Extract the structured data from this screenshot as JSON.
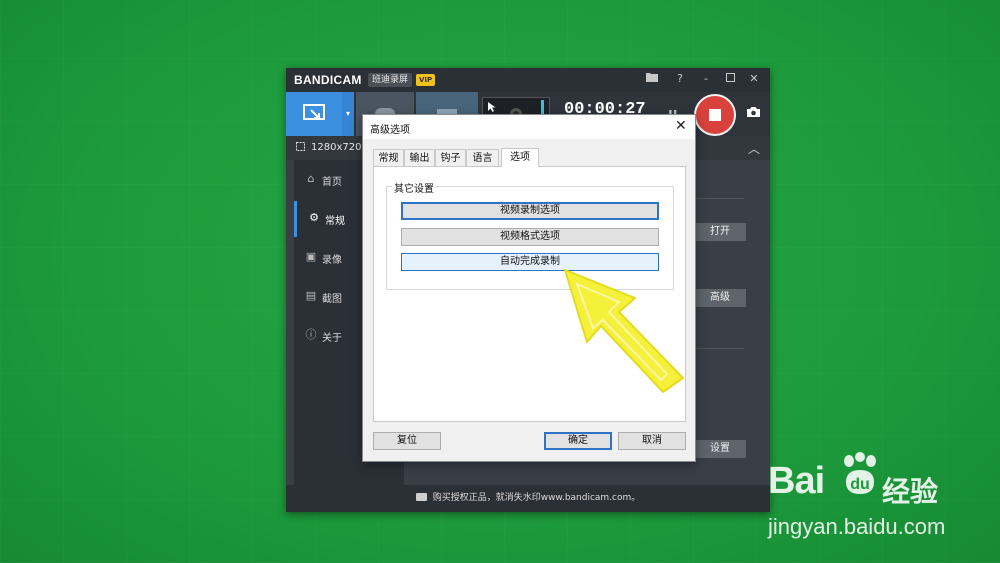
{
  "app": {
    "brand": "BANDICAM",
    "brand_sub": "班迪录屏",
    "vip_badge": "VIP",
    "titlebar_icons": [
      "folder-icon",
      "help-icon",
      "minimize-icon",
      "restore-icon",
      "close-icon"
    ],
    "timer": "00:00:27",
    "resolution": "1280x720"
  },
  "sidebar": {
    "items": [
      {
        "label": "首页",
        "icon": "home-icon"
      },
      {
        "label": "常规",
        "icon": "gear-icon",
        "active": true
      },
      {
        "label": "录像",
        "icon": "video-icon"
      },
      {
        "label": "截图",
        "icon": "image-icon"
      },
      {
        "label": "关于",
        "icon": "info-icon"
      }
    ]
  },
  "content": {
    "open_button": "打开",
    "advanced_button": "高级",
    "settings_button": "设置"
  },
  "footer": {
    "text": "购买授权正品，就消失水印www.bandicam.com。"
  },
  "dialog": {
    "title": "高级选项",
    "tabs": [
      "常规",
      "输出",
      "钩子",
      "语言",
      "选项"
    ],
    "active_tab": "选项",
    "group_title": "其它设置",
    "options": [
      "视频录制选项",
      "视频格式选项",
      "自动完成录制"
    ],
    "reset_button": "复位",
    "ok_button": "确定",
    "cancel_button": "取消"
  },
  "watermark": {
    "brand": "Bai",
    "brand_cn": "经验",
    "url": "jingyan.baidu.com"
  },
  "colors": {
    "background": "#1e9c3d",
    "accent": "#3d8fe0",
    "record": "#d9423c",
    "annotation_arrow": "#f5f03a"
  }
}
